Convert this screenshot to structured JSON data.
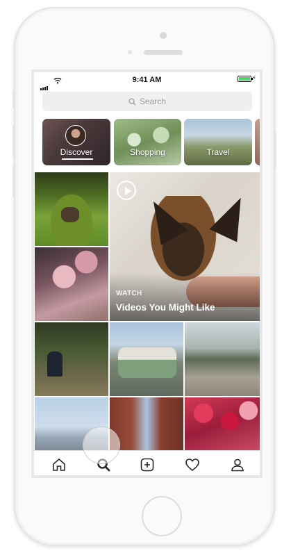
{
  "status_bar": {
    "time": "9:41 AM"
  },
  "search": {
    "placeholder": "Search"
  },
  "channels": [
    {
      "label": "Discover"
    },
    {
      "label": "Shopping"
    },
    {
      "label": "Travel"
    }
  ],
  "featured_video": {
    "kicker": "WATCH",
    "title": "Videos You Might Like"
  },
  "tabs": [
    {
      "icon": "home-icon"
    },
    {
      "icon": "search-icon"
    },
    {
      "icon": "add-post-icon"
    },
    {
      "icon": "heart-icon"
    },
    {
      "icon": "profile-icon"
    }
  ],
  "colors": {
    "battery": "#4cd964",
    "search_bg": "#efefef",
    "search_text": "#9a9a9a"
  }
}
